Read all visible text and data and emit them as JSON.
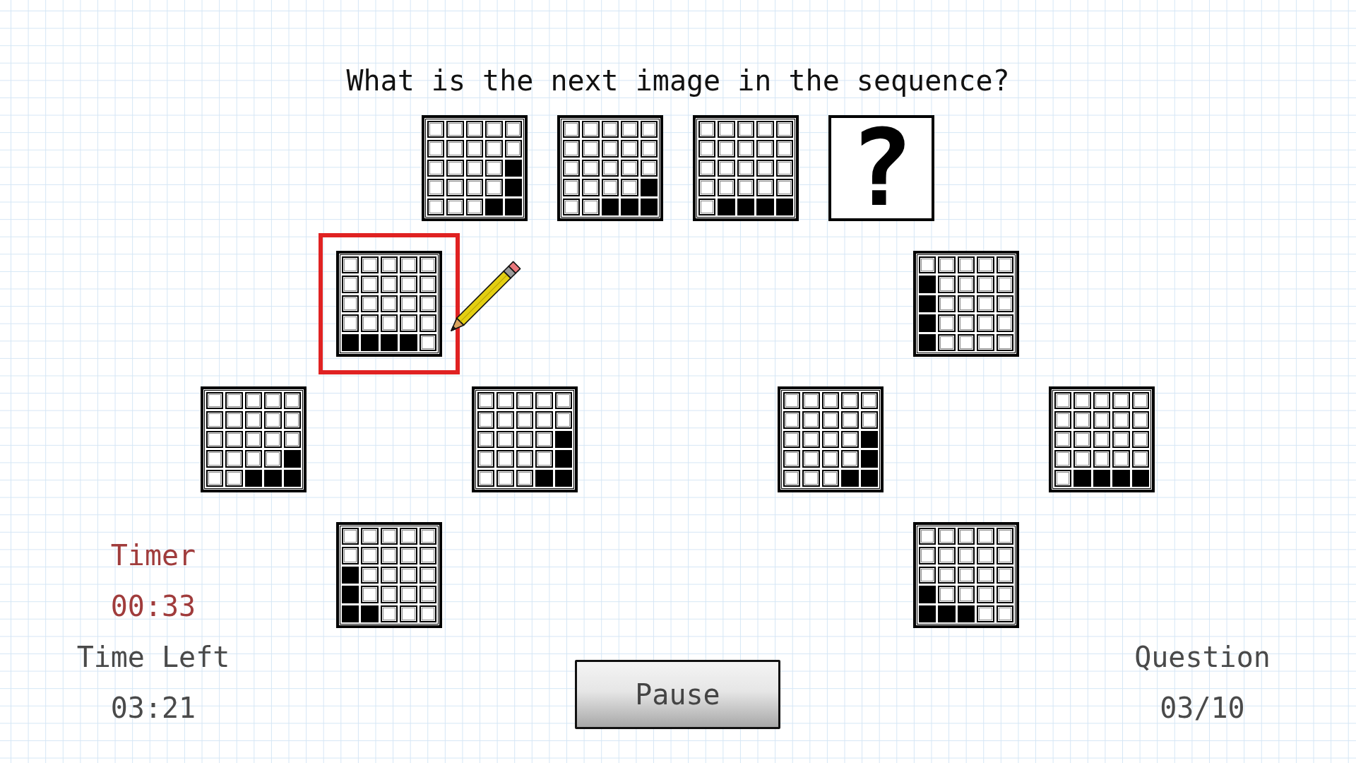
{
  "question": "What is the next image in the sequence?",
  "sequence": [
    {
      "kind": "pattern",
      "rows": [
        [
          false,
          false,
          false,
          false,
          false
        ],
        [
          false,
          false,
          false,
          false,
          false
        ],
        [
          false,
          false,
          false,
          false,
          true
        ],
        [
          false,
          false,
          false,
          false,
          true
        ],
        [
          false,
          false,
          false,
          true,
          true
        ]
      ]
    },
    {
      "kind": "pattern",
      "rows": [
        [
          false,
          false,
          false,
          false,
          false
        ],
        [
          false,
          false,
          false,
          false,
          false
        ],
        [
          false,
          false,
          false,
          false,
          false
        ],
        [
          false,
          false,
          false,
          false,
          true
        ],
        [
          false,
          false,
          true,
          true,
          true
        ]
      ]
    },
    {
      "kind": "pattern",
      "rows": [
        [
          false,
          false,
          false,
          false,
          false
        ],
        [
          false,
          false,
          false,
          false,
          false
        ],
        [
          false,
          false,
          false,
          false,
          false
        ],
        [
          false,
          false,
          false,
          false,
          false
        ],
        [
          false,
          true,
          true,
          true,
          true
        ]
      ]
    },
    {
      "kind": "unknown",
      "symbol": "?"
    }
  ],
  "options": [
    {
      "selected": true,
      "rows": [
        [
          false,
          false,
          false,
          false,
          false
        ],
        [
          false,
          false,
          false,
          false,
          false
        ],
        [
          false,
          false,
          false,
          false,
          false
        ],
        [
          false,
          false,
          false,
          false,
          false
        ],
        [
          true,
          true,
          true,
          true,
          false
        ]
      ]
    },
    {
      "selected": false,
      "rows": [
        [
          false,
          false,
          false,
          false,
          false
        ],
        [
          true,
          false,
          false,
          false,
          false
        ],
        [
          true,
          false,
          false,
          false,
          false
        ],
        [
          true,
          false,
          false,
          false,
          false
        ],
        [
          true,
          false,
          false,
          false,
          false
        ]
      ]
    },
    {
      "selected": false,
      "rows": [
        [
          false,
          false,
          false,
          false,
          false
        ],
        [
          false,
          false,
          false,
          false,
          false
        ],
        [
          false,
          false,
          false,
          false,
          false
        ],
        [
          false,
          false,
          false,
          false,
          true
        ],
        [
          false,
          false,
          true,
          true,
          true
        ]
      ]
    },
    {
      "selected": false,
      "rows": [
        [
          false,
          false,
          false,
          false,
          false
        ],
        [
          false,
          false,
          false,
          false,
          false
        ],
        [
          false,
          false,
          false,
          false,
          true
        ],
        [
          false,
          false,
          false,
          false,
          true
        ],
        [
          false,
          false,
          false,
          true,
          true
        ]
      ]
    },
    {
      "selected": false,
      "rows": [
        [
          false,
          false,
          false,
          false,
          false
        ],
        [
          false,
          false,
          false,
          false,
          false
        ],
        [
          false,
          false,
          false,
          false,
          true
        ],
        [
          false,
          false,
          false,
          false,
          true
        ],
        [
          false,
          false,
          false,
          true,
          true
        ]
      ]
    },
    {
      "selected": false,
      "rows": [
        [
          false,
          false,
          false,
          false,
          false
        ],
        [
          false,
          false,
          false,
          false,
          false
        ],
        [
          false,
          false,
          false,
          false,
          false
        ],
        [
          false,
          false,
          false,
          false,
          false
        ],
        [
          false,
          true,
          true,
          true,
          true
        ]
      ]
    },
    {
      "selected": false,
      "rows": [
        [
          false,
          false,
          false,
          false,
          false
        ],
        [
          false,
          false,
          false,
          false,
          false
        ],
        [
          true,
          false,
          false,
          false,
          false
        ],
        [
          true,
          false,
          false,
          false,
          false
        ],
        [
          true,
          true,
          false,
          false,
          false
        ]
      ]
    },
    {
      "selected": false,
      "rows": [
        [
          false,
          false,
          false,
          false,
          false
        ],
        [
          false,
          false,
          false,
          false,
          false
        ],
        [
          false,
          false,
          false,
          false,
          false
        ],
        [
          true,
          false,
          false,
          false,
          false
        ],
        [
          true,
          true,
          true,
          false,
          false
        ]
      ]
    }
  ],
  "timer": {
    "label": "Timer",
    "value": "00:33"
  },
  "time_left": {
    "label": "Time Left",
    "value": "03:21"
  },
  "question_counter": {
    "label": "Question",
    "value": "03/10"
  },
  "pause_button": {
    "label": "Pause"
  }
}
